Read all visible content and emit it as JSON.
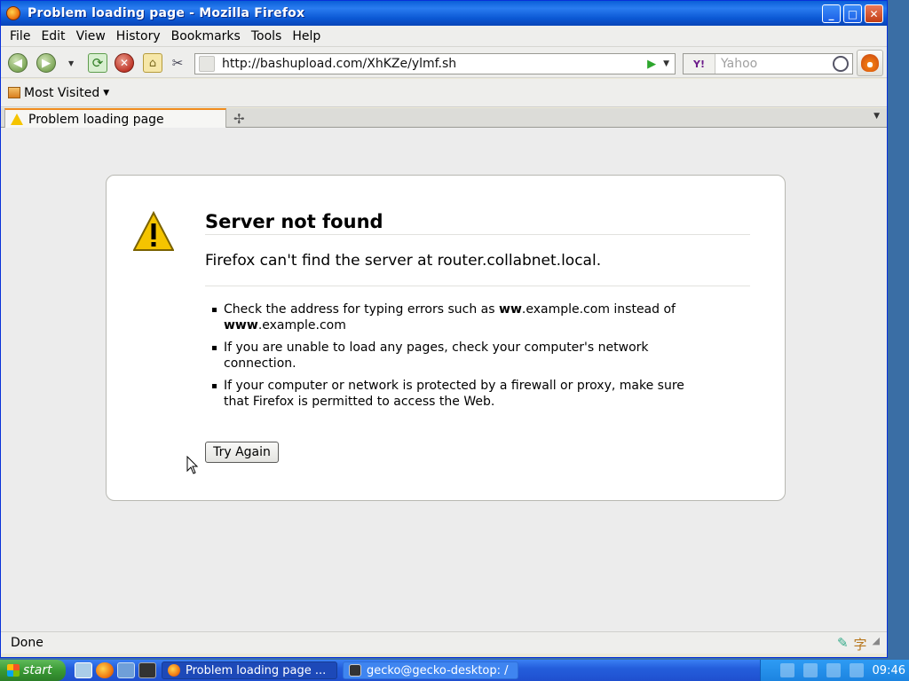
{
  "window": {
    "title": "Problem loading page - Mozilla Firefox",
    "minimize_label": "_",
    "maximize_label": "□",
    "close_label": "✕"
  },
  "menubar": {
    "items": [
      "File",
      "Edit",
      "View",
      "History",
      "Bookmarks",
      "Tools",
      "Help"
    ]
  },
  "navbar": {
    "url": "http://bashupload.com/XhKZe/ylmf.sh",
    "search_placeholder": "Yahoo",
    "search_engine": "Y!"
  },
  "bookmarks": {
    "most_visited": "Most Visited"
  },
  "tabs": {
    "active_label": "Problem loading page",
    "new_tab_icon": "plus-icon"
  },
  "error": {
    "title": "Server not found",
    "short_desc": "Firefox can't find the server at router.collabnet.local.",
    "items": [
      {
        "pre": "Check the address for typing errors such as ",
        "b1": "ww",
        "mid": ".example.com instead of ",
        "b2": "www",
        "post": ".example.com"
      },
      {
        "text": "If you are unable to load any pages, check your computer's network connection."
      },
      {
        "text": "If your computer or network is protected by a firewall or proxy, make sure that Firefox is permitted to access the Web."
      }
    ],
    "try_again": "Try Again"
  },
  "status": {
    "text": "Done"
  },
  "taskbar": {
    "start_label": "start",
    "tasks": [
      "Problem loading page ...",
      "gecko@gecko-desktop: /"
    ],
    "clock": "09:46"
  },
  "colors": {
    "titlebar": "#0a5fd8",
    "tab_accent": "#f08b1d",
    "warning_yellow": "#f5c400",
    "taskbar_blue": "#245edc"
  }
}
